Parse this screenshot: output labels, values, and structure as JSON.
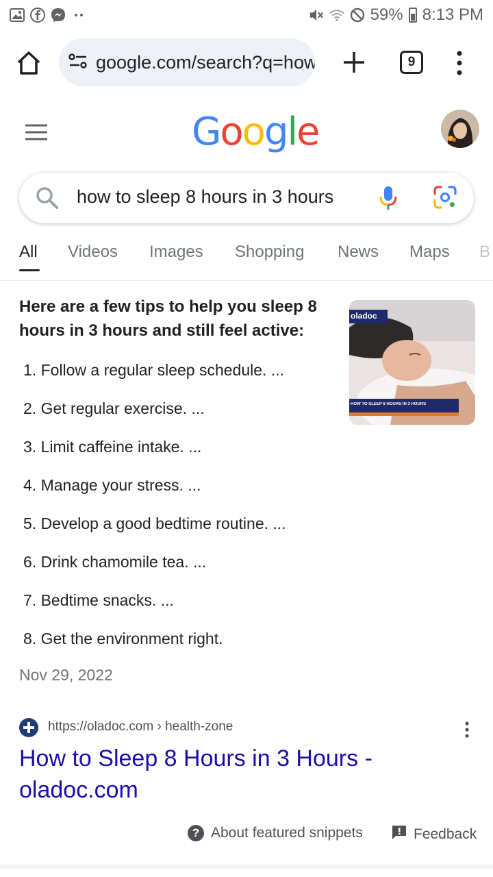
{
  "status_bar": {
    "battery": "59%",
    "time": "8:13 PM",
    "left_icons": [
      "gallery-icon",
      "facebook-icon",
      "messenger-icon",
      "more-dots-icon"
    ],
    "right_icons": [
      "mute-icon",
      "wifi-icon",
      "do-not-disturb-icon",
      "battery-icon"
    ]
  },
  "browser": {
    "url": "google.com/search?q=how",
    "tab_count": "9"
  },
  "google": {
    "logo_letters": [
      "G",
      "o",
      "o",
      "g",
      "l",
      "e"
    ],
    "logo_colors": [
      "#4285F4",
      "#EA4335",
      "#FBBC05",
      "#4285F4",
      "#34A853",
      "#EA4335"
    ]
  },
  "search": {
    "query": "how to sleep 8 hours in 3 hours"
  },
  "tabs": [
    {
      "label": "All",
      "active": true
    },
    {
      "label": "Videos",
      "active": false
    },
    {
      "label": "Images",
      "active": false
    },
    {
      "label": "Shopping",
      "active": false
    },
    {
      "label": "News",
      "active": false
    },
    {
      "label": "Maps",
      "active": false
    },
    {
      "label": "B",
      "active": false
    }
  ],
  "snippet": {
    "heading": "Here are a few tips to help you sleep 8 hours in 3 hours and still feel active:",
    "items": [
      "1. Follow a regular sleep schedule. ...",
      "2. Get regular exercise. ...",
      "3. Limit caffeine intake. ...",
      "4. Manage your stress. ...",
      "5. Develop a good bedtime routine. ...",
      "6. Drink chamomile tea. ...",
      "7. Bedtime snacks. ...",
      "8. Get the environment right."
    ],
    "date": "Nov 29, 2022",
    "image_brand": "oladoc",
    "image_caption": "HOW TO SLEEP 8 HOURS IN 3 HOURS"
  },
  "result": {
    "url": "https://oladoc.com › health-zone",
    "title": "How to Sleep 8 Hours in 3 Hours - oladoc.com"
  },
  "footer": {
    "about": "About featured snippets",
    "feedback": "Feedback"
  }
}
